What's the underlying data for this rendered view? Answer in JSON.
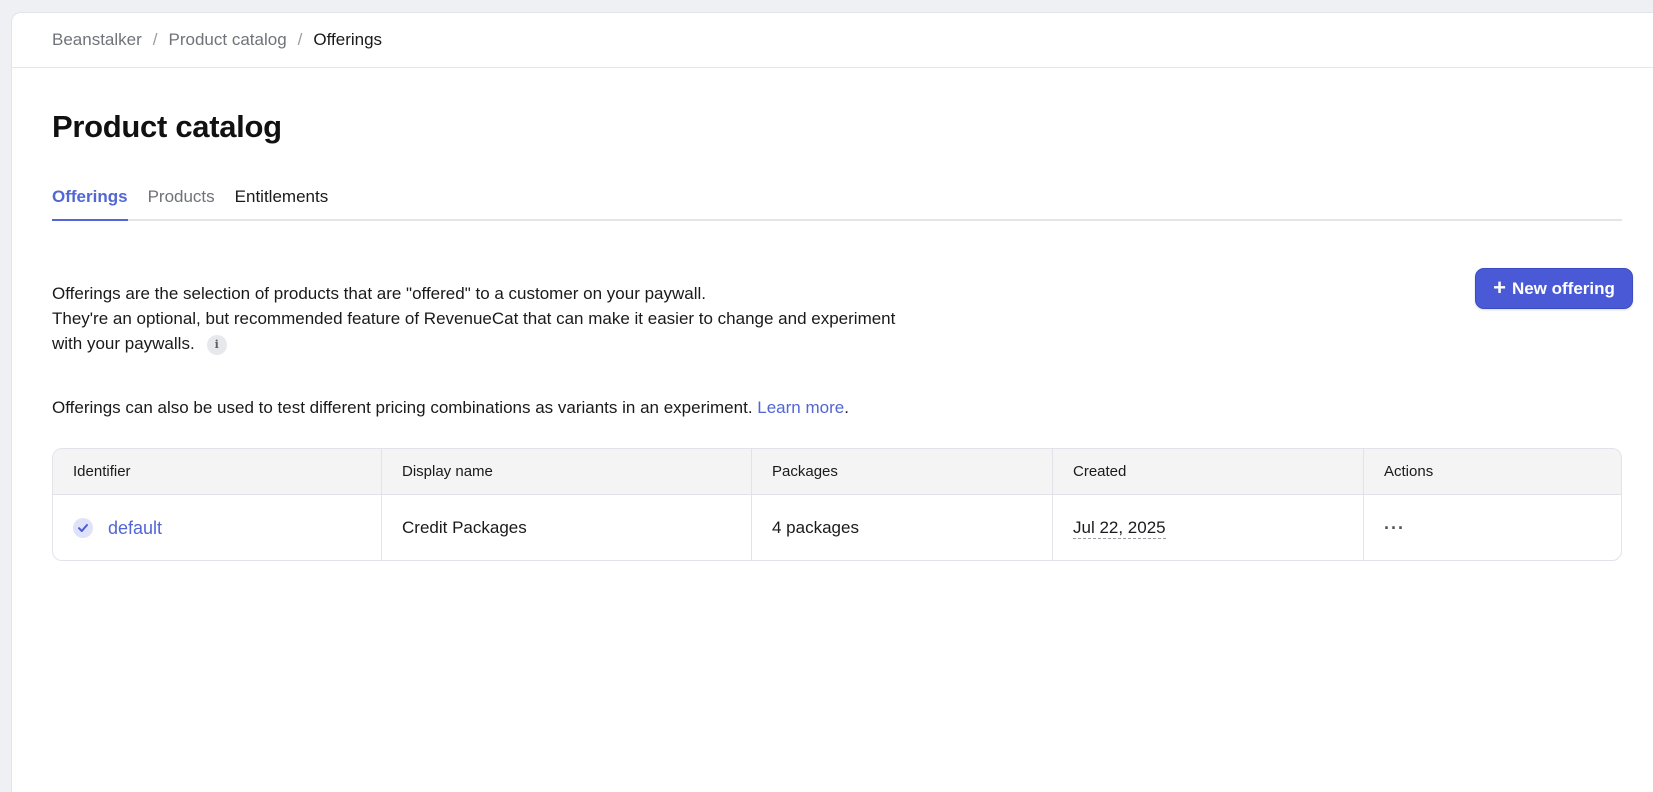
{
  "breadcrumb": {
    "items": [
      "Beanstalker",
      "Product catalog"
    ],
    "current": "Offerings",
    "separator": "/"
  },
  "page": {
    "title": "Product catalog"
  },
  "tabs": [
    {
      "label": "Offerings",
      "active": true
    },
    {
      "label": "Products",
      "active": false
    },
    {
      "label": "Entitlements",
      "active": false
    }
  ],
  "description": {
    "line1": "Offerings are the selection of products that are \"offered\" to a customer on your paywall.",
    "line2": "They're an optional, but recommended feature of RevenueCat that can make it easier to change and experiment with your paywalls.",
    "info_icon": "i",
    "line3_prefix": "Offerings can also be used to test different pricing combinations as variants in an experiment. ",
    "learn_more": "Learn more",
    "line3_suffix": "."
  },
  "actions": {
    "new_offering": "New offering",
    "new_offering_icon": "+"
  },
  "table": {
    "headers": [
      "Identifier",
      "Display name",
      "Packages",
      "Created",
      "Actions"
    ],
    "rows": [
      {
        "identifier": "default",
        "is_default": true,
        "display_name": "Credit Packages",
        "packages": "4 packages",
        "created": "Jul 22, 2025",
        "actions": "···"
      }
    ]
  },
  "colors": {
    "accent": "#5266d4",
    "button": "#4a5ad6"
  }
}
